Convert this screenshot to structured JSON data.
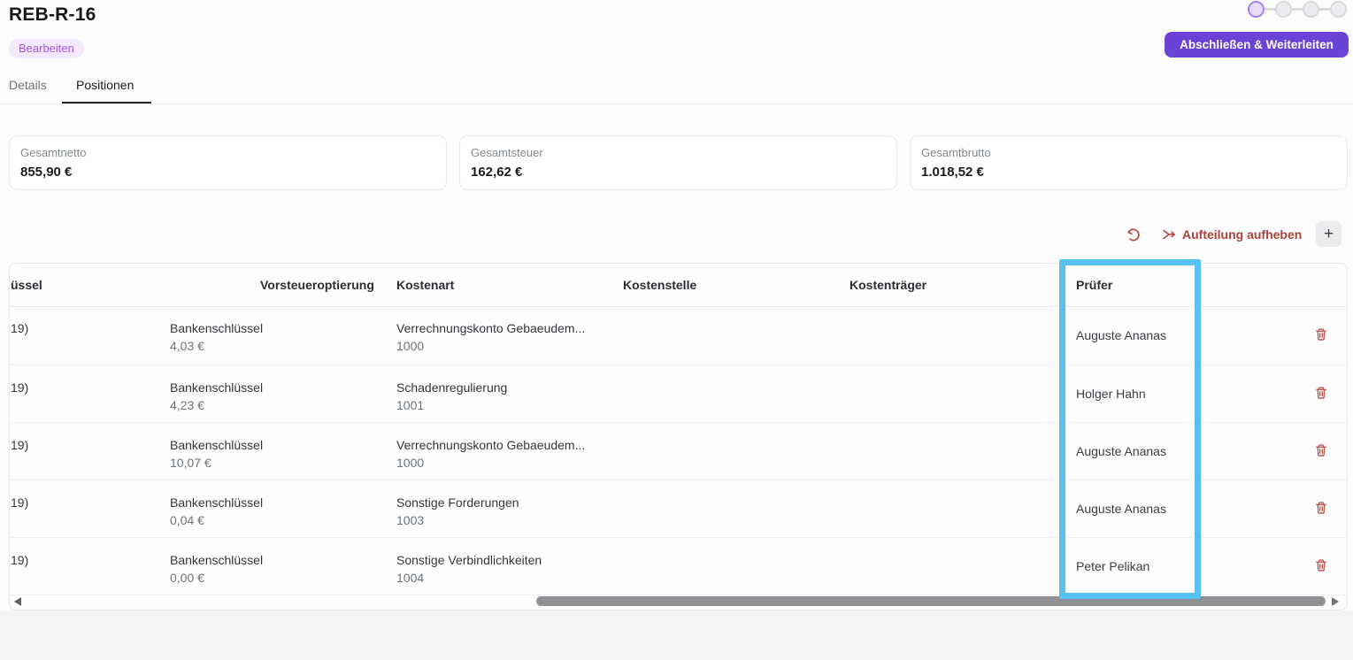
{
  "colors": {
    "accent_purple": "#6b42d6",
    "badge_purple": "#a158e8",
    "danger_red": "#b2443c",
    "highlight_blue": "#57c1f2"
  },
  "header": {
    "title": "REB-R-16",
    "status_badge": "Bearbeiten",
    "primary_action_label": "Abschließen & Weiterleiten",
    "stepper": {
      "total_steps": 4,
      "current_step": 1
    }
  },
  "tabs": [
    {
      "label": "Details",
      "active": false
    },
    {
      "label": "Positionen",
      "active": true
    }
  ],
  "summary_cards": [
    {
      "label": "Gesamtnetto",
      "value": "855,90 €"
    },
    {
      "label": "Gesamtsteuer",
      "value": "162,62 €"
    },
    {
      "label": "Gesamtbrutto",
      "value": "1.018,52 €"
    }
  ],
  "toolbar": {
    "undo_icon": "undo-arrow-icon",
    "unsplit_icon": "merge-arrows-icon",
    "unsplit_label": "Aufteilung aufheben",
    "add_row_label": "+"
  },
  "table": {
    "column_headers": [
      "üssel",
      "Vorsteueroptierung",
      "Kostenart",
      "Kostenstelle",
      "Kostenträger",
      "Prüfer"
    ],
    "highlighted_column": "Prüfer",
    "delete_icon": "trash-icon",
    "rows": [
      {
        "steuerschluessel": "19)",
        "vorsteuer_label": "Bankenschlüssel",
        "vorsteuer_betrag": "4,03 €",
        "kostenart": "Verrechnungskonto Gebaeudem...",
        "kostenart_code": "1000",
        "kostenstelle": "",
        "kostentraeger": "",
        "pruefer": "Auguste Ananas"
      },
      {
        "steuerschluessel": "19)",
        "vorsteuer_label": "Bankenschlüssel",
        "vorsteuer_betrag": "4,23 €",
        "kostenart": "Schadenregulierung",
        "kostenart_code": "1001",
        "kostenstelle": "",
        "kostentraeger": "",
        "pruefer": "Holger Hahn"
      },
      {
        "steuerschluessel": "19)",
        "vorsteuer_label": "Bankenschlüssel",
        "vorsteuer_betrag": "10,07 €",
        "kostenart": "Verrechnungskonto Gebaeudem...",
        "kostenart_code": "1000",
        "kostenstelle": "",
        "kostentraeger": "",
        "pruefer": "Auguste Ananas"
      },
      {
        "steuerschluessel": "19)",
        "vorsteuer_label": "Bankenschlüssel",
        "vorsteuer_betrag": "0,04 €",
        "kostenart": "Sonstige Forderungen",
        "kostenart_code": "1003",
        "kostenstelle": "",
        "kostentraeger": "",
        "pruefer": "Auguste Ananas"
      },
      {
        "steuerschluessel": "19)",
        "vorsteuer_label": "Bankenschlüssel",
        "vorsteuer_betrag": "0,00 €",
        "kostenart": "Sonstige Verbindlichkeiten",
        "kostenart_code": "1004",
        "kostenstelle": "",
        "kostentraeger": "",
        "pruefer": "Peter Pelikan"
      }
    ]
  }
}
